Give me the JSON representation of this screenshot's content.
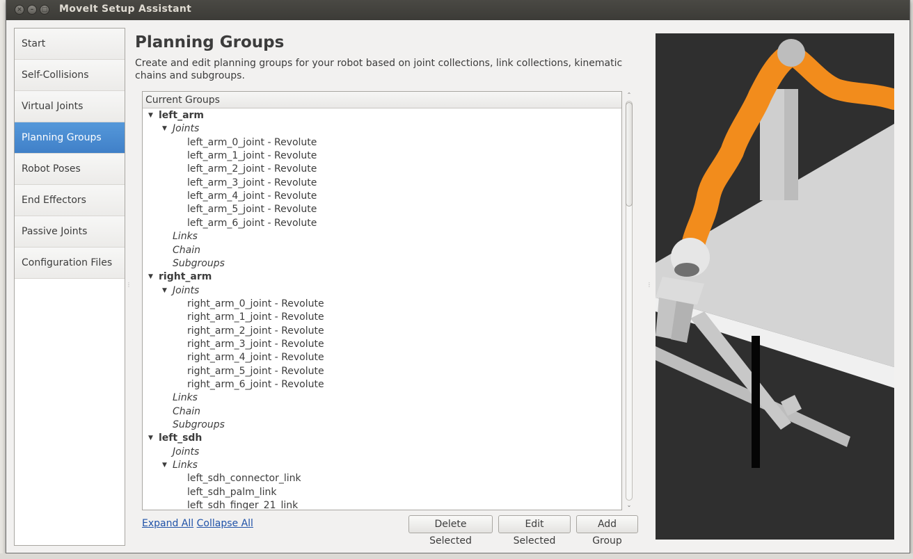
{
  "window": {
    "title": "MoveIt Setup Assistant"
  },
  "sidebar": {
    "items": [
      {
        "label": "Start",
        "active": false
      },
      {
        "label": "Self-Collisions",
        "active": false
      },
      {
        "label": "Virtual Joints",
        "active": false
      },
      {
        "label": "Planning Groups",
        "active": true
      },
      {
        "label": "Robot Poses",
        "active": false
      },
      {
        "label": "End Effectors",
        "active": false
      },
      {
        "label": "Passive Joints",
        "active": false
      },
      {
        "label": "Configuration Files",
        "active": false
      }
    ]
  },
  "main": {
    "title": "Planning Groups",
    "description": "Create and edit planning groups for your robot based on joint collections, link collections, kinematic chains and subgroups.",
    "tree_header": "Current Groups",
    "tree": [
      {
        "text": "left_arm",
        "level": 0,
        "expanded": true
      },
      {
        "text": "Joints",
        "level": 1,
        "expanded": true
      },
      {
        "text": "left_arm_0_joint - Revolute",
        "level": 2
      },
      {
        "text": "left_arm_1_joint - Revolute",
        "level": 2
      },
      {
        "text": "left_arm_2_joint - Revolute",
        "level": 2
      },
      {
        "text": "left_arm_3_joint - Revolute",
        "level": 2
      },
      {
        "text": "left_arm_4_joint - Revolute",
        "level": 2
      },
      {
        "text": "left_arm_5_joint - Revolute",
        "level": 2
      },
      {
        "text": "left_arm_6_joint - Revolute",
        "level": 2
      },
      {
        "text": "Links",
        "level": 1
      },
      {
        "text": "Chain",
        "level": 1
      },
      {
        "text": "Subgroups",
        "level": 1
      },
      {
        "text": "right_arm",
        "level": 0,
        "expanded": true
      },
      {
        "text": "Joints",
        "level": 1,
        "expanded": true
      },
      {
        "text": "right_arm_0_joint - Revolute",
        "level": 2
      },
      {
        "text": "right_arm_1_joint - Revolute",
        "level": 2
      },
      {
        "text": "right_arm_2_joint - Revolute",
        "level": 2
      },
      {
        "text": "right_arm_3_joint - Revolute",
        "level": 2
      },
      {
        "text": "right_arm_4_joint - Revolute",
        "level": 2
      },
      {
        "text": "right_arm_5_joint - Revolute",
        "level": 2
      },
      {
        "text": "right_arm_6_joint - Revolute",
        "level": 2
      },
      {
        "text": "Links",
        "level": 1
      },
      {
        "text": "Chain",
        "level": 1
      },
      {
        "text": "Subgroups",
        "level": 1
      },
      {
        "text": "left_sdh",
        "level": 0,
        "expanded": true
      },
      {
        "text": "Joints",
        "level": 1
      },
      {
        "text": "Links",
        "level": 1,
        "expanded": true
      },
      {
        "text": "left_sdh_connector_link",
        "level": 2
      },
      {
        "text": "left_sdh_palm_link",
        "level": 2
      },
      {
        "text": "left_sdh_finger_21_link",
        "level": 2
      }
    ],
    "expand_all": "Expand All",
    "collapse_all": "Collapse All",
    "buttons": {
      "delete": "Delete Selected",
      "edit": "Edit Selected",
      "add": "Add Group"
    }
  },
  "colors": {
    "accent": "#4a8cd4",
    "robot_orange": "#f28c1c",
    "viewport_bg": "#2f2f2f"
  }
}
